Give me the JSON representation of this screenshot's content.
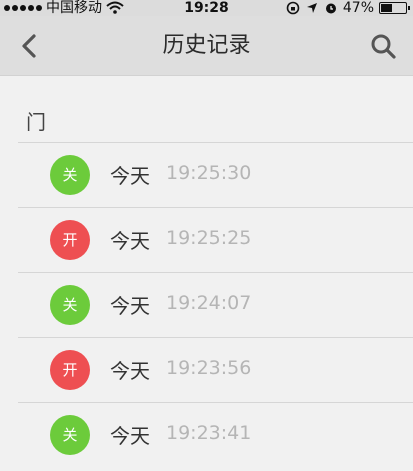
{
  "status_bar": {
    "carrier": "中国移动",
    "time": "19:28",
    "battery_percent": "47%",
    "battery_level": 0.47
  },
  "nav": {
    "title": "历史记录"
  },
  "section": {
    "title": "门"
  },
  "records": [
    {
      "state_label": "关",
      "state": "off",
      "day": "今天",
      "time": "19:25:30"
    },
    {
      "state_label": "开",
      "state": "on",
      "day": "今天",
      "time": "19:25:25"
    },
    {
      "state_label": "关",
      "state": "off",
      "day": "今天",
      "time": "19:24:07"
    },
    {
      "state_label": "开",
      "state": "on",
      "day": "今天",
      "time": "19:23:56"
    },
    {
      "state_label": "关",
      "state": "off",
      "day": "今天",
      "time": "19:23:41"
    }
  ],
  "colors": {
    "off": "#6ccb3b",
    "on": "#ee4f52"
  }
}
